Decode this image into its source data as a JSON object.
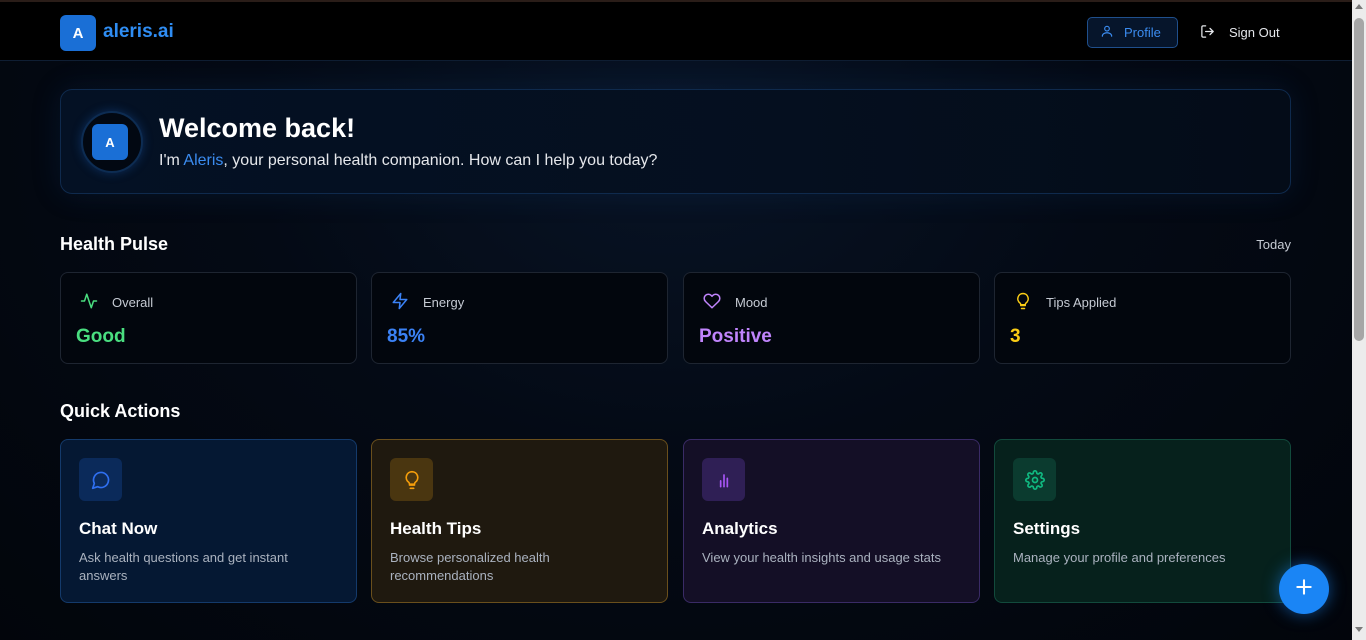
{
  "header": {
    "logo_letter": "A",
    "brand": "aleris.ai",
    "profile_label": "Profile",
    "signout_label": "Sign Out"
  },
  "welcome": {
    "avatar_letter": "A",
    "title": "Welcome back!",
    "sub_prefix": "I'm ",
    "sub_name": "Aleris",
    "sub_suffix": ", your personal health companion. How can I help you today?"
  },
  "health_pulse": {
    "title": "Health Pulse",
    "period": "Today",
    "stats": [
      {
        "label": "Overall",
        "value": "Good",
        "icon": "activity-icon",
        "color": "#4ade80"
      },
      {
        "label": "Energy",
        "value": "85%",
        "icon": "lightning-icon",
        "color": "#3b82f6"
      },
      {
        "label": "Mood",
        "value": "Positive",
        "icon": "heart-icon",
        "color": "#c084fc"
      },
      {
        "label": "Tips Applied",
        "value": "3",
        "icon": "lightbulb-icon",
        "color": "#facc15"
      }
    ]
  },
  "quick_actions": {
    "title": "Quick Actions",
    "items": [
      {
        "title": "Chat Now",
        "desc": "Ask health questions and get instant answers",
        "icon": "chat-icon",
        "color": "#2563eb"
      },
      {
        "title": "Health Tips",
        "desc": "Browse personalized health recommendations",
        "icon": "lightbulb-icon",
        "color": "#f59e0b"
      },
      {
        "title": "Analytics",
        "desc": "View your health insights and usage stats",
        "icon": "bar-chart-icon",
        "color": "#a855f7"
      },
      {
        "title": "Settings",
        "desc": "Manage your profile and preferences",
        "icon": "gear-icon",
        "color": "#10b981"
      }
    ]
  },
  "fab": {
    "icon": "plus-icon",
    "color": "#1a85f5"
  }
}
